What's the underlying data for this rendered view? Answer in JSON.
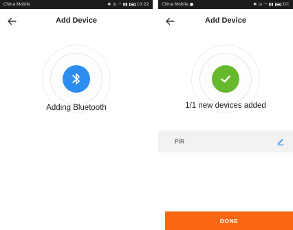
{
  "colors": {
    "accent": "#2d8cf0",
    "success": "#66b82c",
    "done_button": "#fa6713"
  },
  "left": {
    "status": {
      "carrier": "China Mobile",
      "indicators": "✱ ⏰ ◠ ᴴᵈ ▐▌",
      "time": "10:22"
    },
    "nav": {
      "back_icon": "back-arrow-icon",
      "title": "Add Device"
    },
    "badge_icon": "bluetooth-icon",
    "caption": "Adding Bluetooth"
  },
  "right": {
    "status": {
      "carrier": "China Mobile",
      "indicators": "✱ ⏰ ◠ ᴴᵈ ▐▌",
      "time": "10:"
    },
    "nav": {
      "back_icon": "back-arrow-icon",
      "title": "Add Device"
    },
    "badge_icon": "checkmark-icon",
    "caption": "1/1 new devices added",
    "device": {
      "name": "PIR",
      "edit_icon": "pencil-icon"
    },
    "done_label": "DONE"
  }
}
